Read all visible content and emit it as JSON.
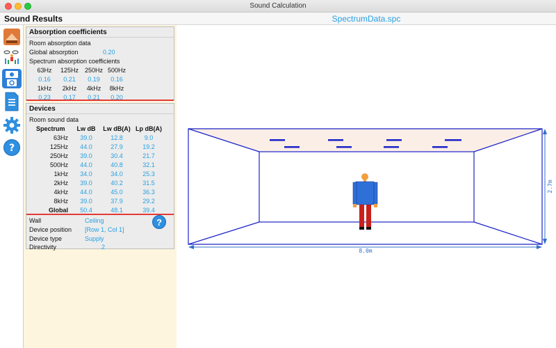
{
  "window": {
    "title": "Sound Calculation"
  },
  "header": {
    "section_title": "Sound Results",
    "file_name": "SpectrumData.spc"
  },
  "rail": {
    "items": [
      {
        "name": "room-icon"
      },
      {
        "name": "devices-icon"
      },
      {
        "name": "sound-device-icon"
      },
      {
        "name": "document-icon"
      },
      {
        "name": "settings-gear-icon"
      },
      {
        "name": "help-icon"
      }
    ]
  },
  "absorption": {
    "title": "Absorption coefficients",
    "room_label": "Room absorption data",
    "global_label": "Global absorption",
    "global_value": "0.20",
    "spectrum_label": "Spectrum absorption coefficients",
    "bands_low": [
      "63Hz",
      "125Hz",
      "250Hz",
      "500Hz"
    ],
    "values_low": [
      "0.16",
      "0.21",
      "0.19",
      "0.16"
    ],
    "bands_high": [
      "1kHz",
      "2kHz",
      "4kHz",
      "8kHz"
    ],
    "values_high": [
      "0.23",
      "0.17",
      "0.21",
      "0.20"
    ]
  },
  "devices": {
    "title": "Devices",
    "room_sound_label": "Room sound data",
    "headers": [
      "Spectrum",
      "Lw dB",
      "Lw dB(A)",
      "Lp dB(A)"
    ],
    "rows": [
      {
        "band": "63Hz",
        "lw": "39.0",
        "lwa": "12.8",
        "lpa": "9.0"
      },
      {
        "band": "125Hz",
        "lw": "44.0",
        "lwa": "27.9",
        "lpa": "19.2"
      },
      {
        "band": "250Hz",
        "lw": "39.0",
        "lwa": "30.4",
        "lpa": "21.7"
      },
      {
        "band": "500Hz",
        "lw": "44.0",
        "lwa": "40.8",
        "lpa": "32.1"
      },
      {
        "band": "1kHz",
        "lw": "34.0",
        "lwa": "34.0",
        "lpa": "25.3"
      },
      {
        "band": "2kHz",
        "lw": "39.0",
        "lwa": "40.2",
        "lpa": "31.5"
      },
      {
        "band": "4kHz",
        "lw": "44.0",
        "lwa": "45.0",
        "lpa": "36.3"
      },
      {
        "band": "8kHz",
        "lw": "39.0",
        "lwa": "37.9",
        "lpa": "29.2"
      }
    ],
    "global": {
      "band": "Global",
      "lw": "50.4",
      "lwa": "48.1",
      "lpa": "39.4"
    },
    "wall_label": "Wall",
    "wall_value": "Ceiling",
    "position_label": "Device position",
    "position_value": "[Row 1, Col 1]",
    "type_label": "Device type",
    "type_value": "Supply",
    "directivity_label": "Directivity",
    "directivity_value": "2",
    "help_glyph": "?"
  },
  "view": {
    "width_label": "8.0m",
    "height_label": "2.7m"
  },
  "colors": {
    "accent": "#27a0e3",
    "red": "#e53935",
    "panel_bg": "#fdf5dd",
    "room_line": "#1a22c8",
    "ceiling_tint": "#fbeee6"
  }
}
